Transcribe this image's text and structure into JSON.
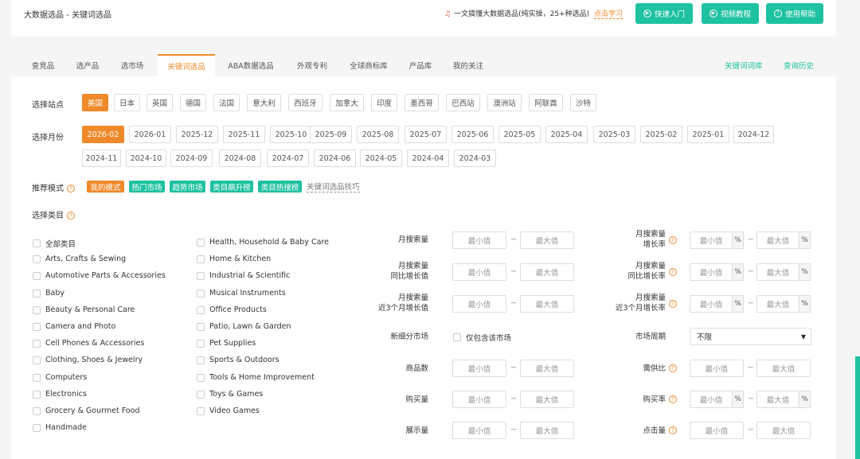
{
  "header": {
    "title": "大数据选品 - 关键词选品",
    "notice_text": "一文搞懂大数据选品(纯实操，25+种选品)",
    "notice_link": "点击学习",
    "quick_start": "快速入门",
    "video_tutorial": "视频教程",
    "help": "使用帮助"
  },
  "tabs": [
    "查竞品",
    "选产品",
    "选市场",
    "关键词选品",
    "ABA数据选品",
    "外观专利",
    "全球商标库",
    "产品库",
    "我的关注"
  ],
  "tabs_right": [
    "关键词词库",
    "查询历史"
  ],
  "site": {
    "label": "选择站点",
    "options": [
      "美国",
      "日本",
      "英国",
      "德国",
      "法国",
      "意大利",
      "西班牙",
      "加拿大",
      "印度",
      "墨西哥",
      "巴西站",
      "澳洲站",
      "阿联酋",
      "沙特"
    ]
  },
  "month": {
    "label": "选择月份",
    "row1": [
      "2026-02",
      "2026-01",
      "2025-12",
      "2025-11",
      "2025-10",
      "2025-09",
      "2025-08",
      "2025-07",
      "2025-06",
      "2025-05",
      "2025-04",
      "2025-03",
      "2025-02",
      "2025-01",
      "2024-12"
    ],
    "row2": [
      "2024-11",
      "2024-10",
      "2024-09",
      "2024-08",
      "2024-07",
      "2024-06",
      "2024-05",
      "2024-04",
      "2024-03"
    ]
  },
  "mode": {
    "label": "推荐模式",
    "options": [
      "我的模式",
      "热门市场",
      "趋势市场",
      "类目飙升榜",
      "类目热搜榜"
    ],
    "tips": "关键词选品技巧"
  },
  "category": {
    "label": "选择类目",
    "col1": [
      "全部类目",
      "Arts, Crafts & Sewing",
      "Automotive Parts & Accessories",
      "Baby",
      "Beauty & Personal Care",
      "Camera and Photo",
      "Cell Phones & Accessories",
      "Clothing, Shoes & Jewelry",
      "Computers",
      "Electronics",
      "Grocery & Gourmet Food",
      "Handmade"
    ],
    "col2": [
      "Health, Household & Baby Care",
      "Home & Kitchen",
      "Industrial & Scientific",
      "Musical Instruments",
      "Office Products",
      "Patio, Lawn & Garden",
      "Pet Supplies",
      "Sports & Outdoors",
      "Tools & Home Improvement",
      "Toys & Games",
      "Video Games"
    ]
  },
  "filters": {
    "min": "最小值",
    "max": "最大值",
    "pct": "%",
    "tilde": "~",
    "monthly_search": "月搜索量",
    "search_growth": [
      "月搜索量",
      "增长率"
    ],
    "yoy_value": [
      "月搜索量",
      "同比增长值"
    ],
    "yoy_rate": [
      "月搜索量",
      "同比增长率"
    ],
    "q3_value": [
      "月搜索量",
      "近3个月增长值"
    ],
    "q3_rate": [
      "月搜索量",
      "近3个月增长率"
    ],
    "new_market": "新细分市场",
    "new_market_check": "仅包含该市场",
    "market_cycle": "市场周期",
    "market_cycle_value": "不限",
    "product_count": "商品数",
    "supply_demand": "需供比",
    "purchases": "购买量",
    "purchase_rate": "购买率",
    "impressions": "展示量",
    "clicks": "点击量"
  }
}
